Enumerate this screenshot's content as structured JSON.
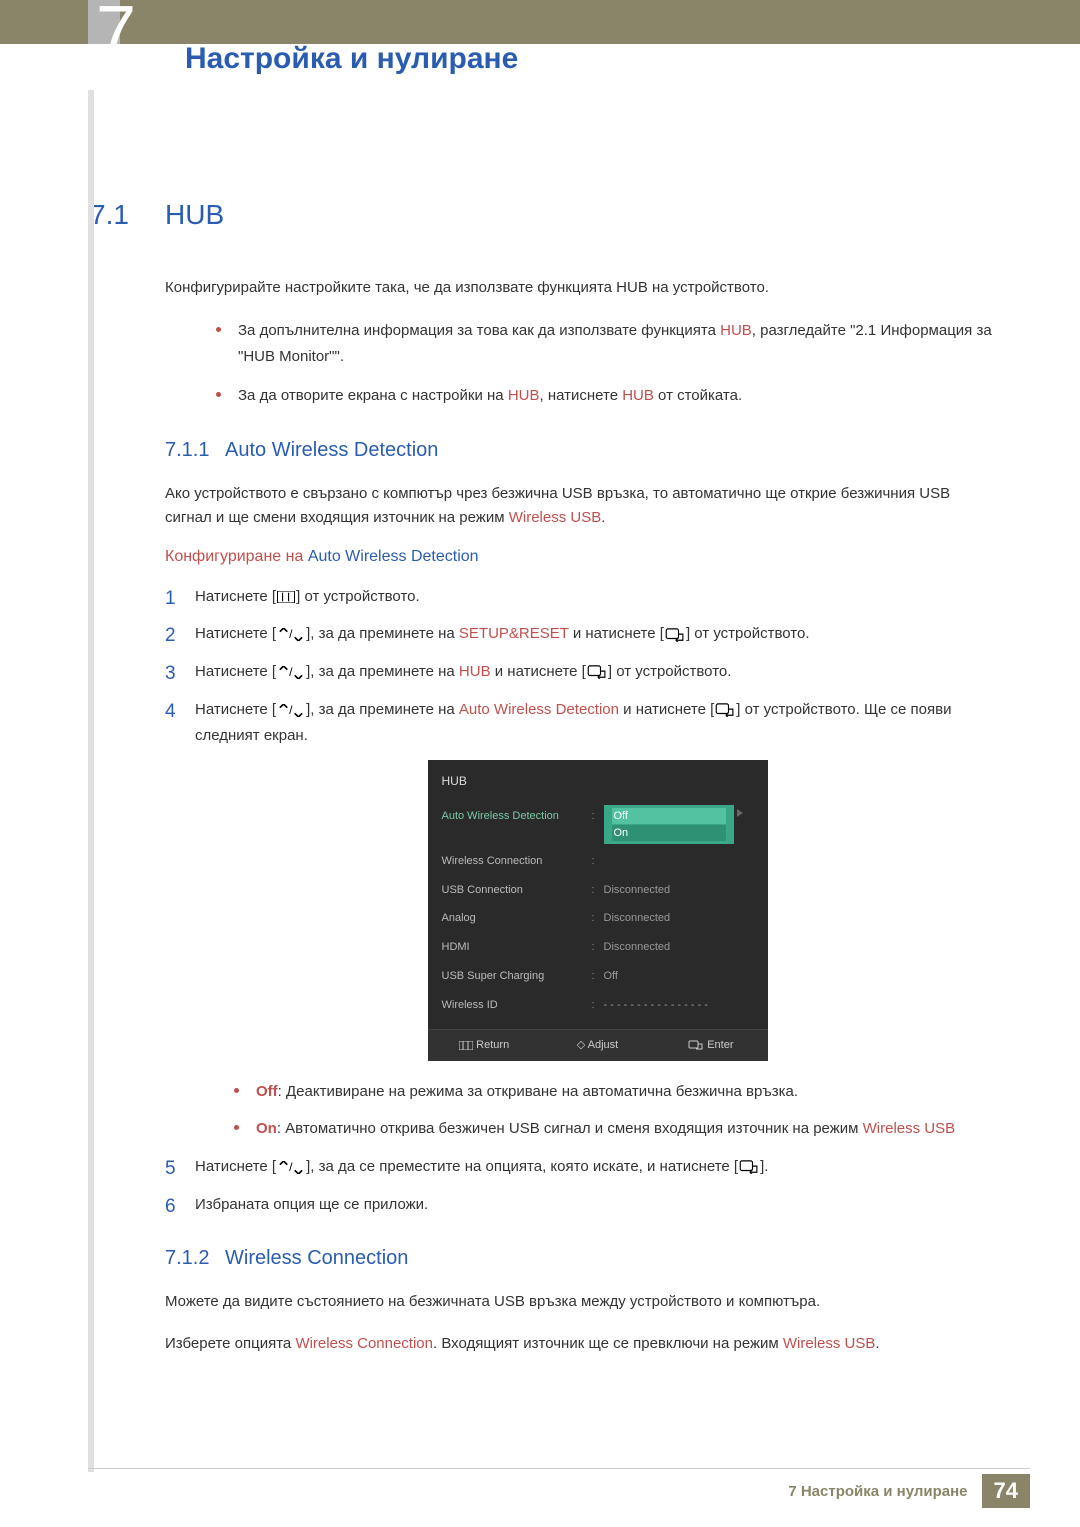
{
  "chapter": {
    "number": "7",
    "title": "Настройка и нулиране"
  },
  "section": {
    "number": "7.1",
    "title": "HUB",
    "intro": "Конфигурирайте настройките така, че да използвате функцията HUB на устройството.",
    "bullets": [
      {
        "pre": "За допълнителна информация за това как да използвате функцията ",
        "red": "HUB",
        "post": ", разгледайте \"2.1 Информация за \"HUB Monitor\"\"."
      },
      {
        "pre": "За да отворите екрана с настройки на ",
        "red": "HUB",
        "mid": ", натиснете ",
        "red2": "HUB",
        "post": " от стойката."
      }
    ]
  },
  "sub711": {
    "number": "7.1.1",
    "title": "Auto Wireless Detection",
    "intro_pre": "Ако устройството е свързано с компютър чрез безжична USB връзка, то автоматично ще открие безжичния USB сигнал и ще смени входящия източник на режим ",
    "intro_red": "Wireless USB",
    "intro_post": ".",
    "config_heading_red": "Конфигуриране на ",
    "config_heading_blue": "Auto Wireless Detection",
    "steps": {
      "s1": {
        "pre": "Натиснете [",
        "post": "] от устройството."
      },
      "s2": {
        "pre": "Натиснете [",
        "mid1": "], за да преминете на ",
        "red1": "SETUP&RESET",
        "mid2": " и натиснете [",
        "post": "] от устройството."
      },
      "s3": {
        "pre": "Натиснете [",
        "mid1": "], за да преминете на ",
        "red1": "HUB",
        "mid2": " и натиснете [",
        "post": "] от устройството."
      },
      "s4": {
        "pre": "Натиснете [",
        "mid1": "], за да преминете на ",
        "red1": "Auto Wireless Detection",
        "mid2": " и натиснете [",
        "post": "] от устройството. Ще се появи следният екран."
      },
      "s5": {
        "pre": "Натиснете [",
        "mid1": "], за да се преместите на опцията, която искате, и натиснете [",
        "post": "]."
      },
      "s6": "Избраната опция ще се приложи."
    },
    "optbullets": [
      {
        "b": "Off",
        "text": ": Деактивиране на режима за откриване на автоматична безжична връзка."
      },
      {
        "b": "On",
        "text": ": Автоматично открива безжичен USB сигнал и сменя входящия източник на режим ",
        "red": "Wireless USB"
      }
    ]
  },
  "osd": {
    "title": "HUB",
    "rows": [
      {
        "label": "Auto Wireless Detection",
        "sel": true,
        "dropdown": {
          "off": "Off",
          "on": "On"
        }
      },
      {
        "label": "Wireless Connection",
        "value": ""
      },
      {
        "label": "USB Connection",
        "value": "Disconnected"
      },
      {
        "label": "Analog",
        "value": "Disconnected"
      },
      {
        "label": "HDMI",
        "value": "Disconnected"
      },
      {
        "label": "USB Super Charging",
        "value": "Off"
      },
      {
        "label": "Wireless ID",
        "value": "- - - - - - - - - - - - - - - -"
      }
    ],
    "footer": {
      "return": "Return",
      "adjust": "Adjust",
      "enter": "Enter"
    }
  },
  "sub712": {
    "number": "7.1.2",
    "title": "Wireless Connection",
    "p1": "Можете да видите състоянието на безжичната USB връзка между устройството и компютъра.",
    "p2_pre": "Изберете опцията ",
    "p2_red1": "Wireless Connection",
    "p2_mid": ". Входящият източник ще се превключи на режим ",
    "p2_red2": "Wireless USB",
    "p2_post": "."
  },
  "footer": {
    "chapter_label": "7 Настройка и нулиране",
    "page": "74"
  }
}
